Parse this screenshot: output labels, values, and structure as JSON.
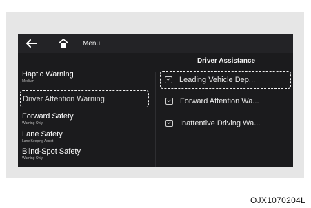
{
  "topbar": {
    "menu_label": "Menu"
  },
  "right_panel": {
    "title": "Driver Assistance",
    "items": [
      {
        "label": "Leading Vehicle Dep...",
        "selected": true
      },
      {
        "label": "Forward Attention Wa...",
        "selected": false
      },
      {
        "label": "Inattentive Driving Wa...",
        "selected": false
      }
    ]
  },
  "left_panel": {
    "items": [
      {
        "label": "Haptic Warning",
        "sub": "Medium"
      },
      {
        "label": "Driver Attention Warning",
        "sub": ""
      },
      {
        "label": "Forward Safety",
        "sub": "Warning Only"
      },
      {
        "label": "Lane Safety",
        "sub": "Lane Keeping Assist"
      },
      {
        "label": "Blind-Spot Safety",
        "sub": "Warning Only"
      }
    ]
  },
  "figure_code": "OJX1070204L"
}
